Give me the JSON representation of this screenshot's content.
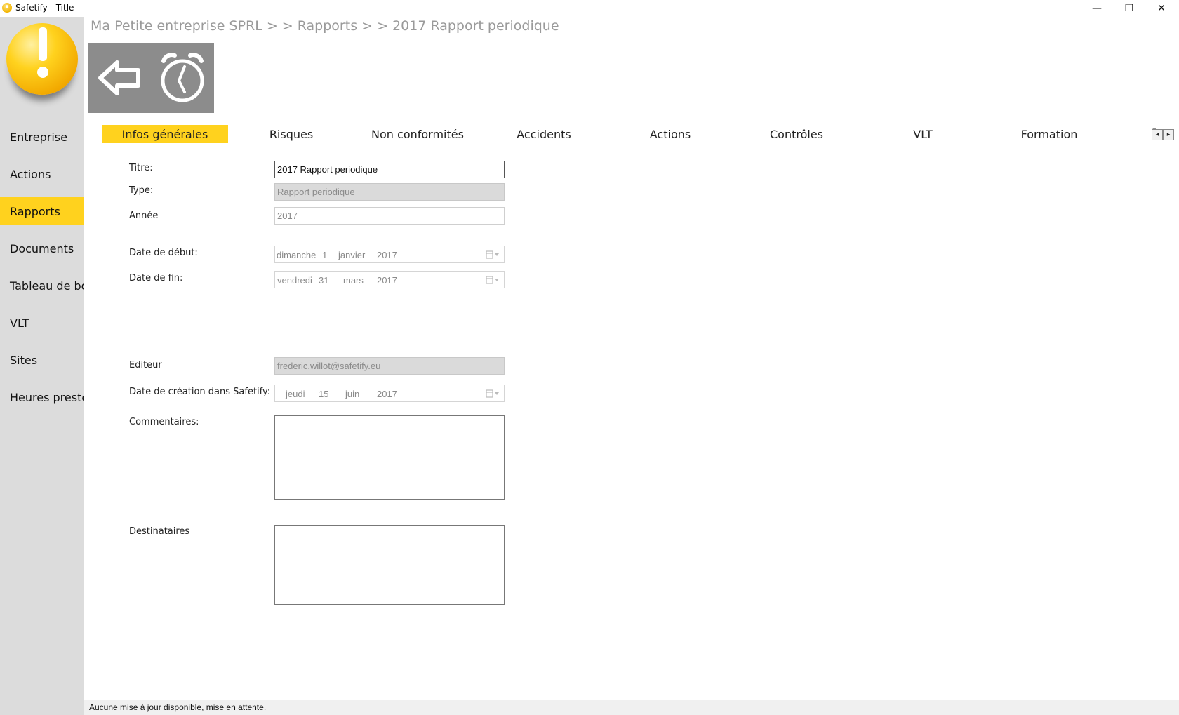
{
  "window": {
    "title": "Safetify - Title",
    "minimize_icon": "—",
    "maximize_icon": "❐",
    "close_icon": "✕"
  },
  "sidebar": {
    "items": [
      {
        "label": "Entreprise",
        "active": false
      },
      {
        "label": "Actions",
        "active": false
      },
      {
        "label": "Rapports",
        "active": true
      },
      {
        "label": "Documents",
        "active": false
      },
      {
        "label": "Tableau de bord",
        "active": false
      },
      {
        "label": "VLT",
        "active": false
      },
      {
        "label": "Sites",
        "active": false
      },
      {
        "label": "Heures prestées",
        "active": false
      }
    ]
  },
  "breadcrumb": "Ma Petite entreprise SPRL  > >  Rapports  > >  2017 Rapport periodique",
  "tabs": [
    {
      "label": "Infos générales",
      "active": true
    },
    {
      "label": "Risques",
      "active": false
    },
    {
      "label": "Non conformités",
      "active": false
    },
    {
      "label": "Accidents",
      "active": false
    },
    {
      "label": "Actions",
      "active": false
    },
    {
      "label": "Contrôles",
      "active": false
    },
    {
      "label": "VLT",
      "active": false
    },
    {
      "label": "Formation",
      "active": false
    }
  ],
  "tab_overflow_label": "F",
  "form": {
    "titre_label": "Titre:",
    "titre_value": "2017 Rapport periodique",
    "type_label": "Type:",
    "type_value": "Rapport periodique",
    "annee_label": "Année",
    "annee_value": "2017",
    "date_debut_label": "Date de début:",
    "date_debut": {
      "weekday": "dimanche",
      "day": "1",
      "month": "janvier",
      "year": "2017"
    },
    "date_fin_label": "Date de fin:",
    "date_fin": {
      "weekday": "vendredi",
      "day": "31",
      "month": "mars",
      "year": "2017"
    },
    "editeur_label": "Editeur",
    "editeur_value": "frederic.willot@safetify.eu",
    "date_creation_label": "Date de création dans Safetify:",
    "date_creation": {
      "weekday": "jeudi",
      "day": "15",
      "month": "juin",
      "year": "2017"
    },
    "commentaires_label": "Commentaires:",
    "commentaires_value": "",
    "destinataires_label": "Destinataires",
    "destinataires_value": ""
  },
  "statusbar": "Aucune mise à jour disponible, mise en attente.",
  "colors": {
    "accent": "#ffd21e",
    "sidebar_bg": "#dcdcdc",
    "toolbar_bg": "#8c8c8c",
    "breadcrumb": "#9a9a9a"
  },
  "icons": {
    "back": "back-arrow-icon",
    "timer": "stopwatch-icon",
    "calendar": "calendar-dropdown-icon",
    "logo": "exclamation-logo-icon"
  }
}
